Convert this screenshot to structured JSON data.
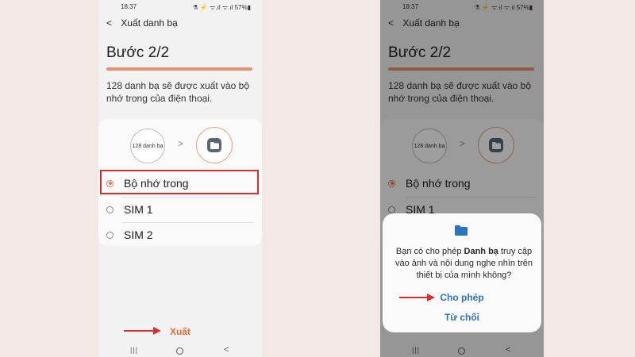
{
  "status": {
    "time": "18:37",
    "right_icons": "⚗ ⚡ ᯤ.ıl ᯤ.ıl 57%▮"
  },
  "left_phone": {
    "app_title": "Xuất danh bạ",
    "step": "Bước 2/2",
    "progress": 1.0,
    "description": "128 danh bạ sẽ được xuất vào bộ nhớ trong của điện thoại.",
    "count_label": "128 danh bạ",
    "options": [
      {
        "label": "Bộ nhớ trong",
        "selected": true
      },
      {
        "label": "SIM 1",
        "selected": false
      },
      {
        "label": "SIM 2",
        "selected": false
      }
    ],
    "export_label": "Xuất"
  },
  "right_phone": {
    "app_title": "Xuất danh bạ",
    "step": "Bước 2/2",
    "description": "128 danh bạ sẽ được xuất vào bộ nhớ trong của điện thoại.",
    "count_label": "128 danh bạ",
    "options": [
      {
        "label": "Bộ nhớ trong",
        "selected": true
      },
      {
        "label": "SIM 1",
        "selected": false
      }
    ],
    "dialog": {
      "text_before": "Bạn có cho phép ",
      "text_bold": "Danh bạ",
      "text_after": " truy cập vào ảnh và nội dung nghe nhìn trên thiết bị của mình không?",
      "allow_label": "Cho phép",
      "deny_label": "Từ chối"
    }
  },
  "colors": {
    "accent_orange": "#e36a35",
    "highlight_red": "#d92e2e",
    "dialog_blue": "#2b73c2"
  }
}
